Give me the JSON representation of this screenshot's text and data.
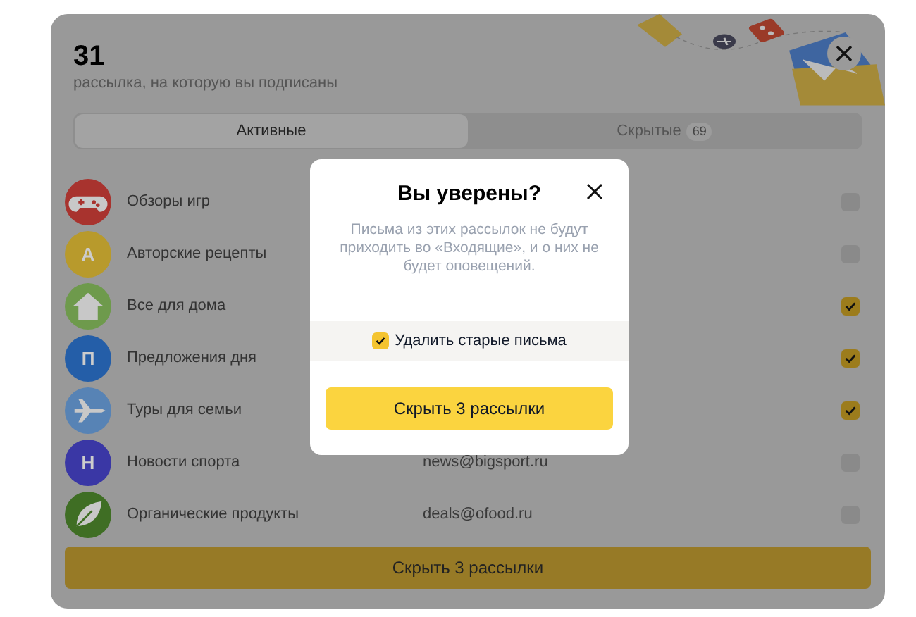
{
  "header": {
    "count": "31",
    "subtitle": "рассылка, на которую вы подписаны"
  },
  "tabs": [
    {
      "label": "Активные",
      "selected": true
    },
    {
      "label": "Скрытые",
      "badge": "69",
      "selected": false
    }
  ],
  "subscriptions": [
    {
      "name": "Обзоры игр",
      "checked": false,
      "color": "#a8332e",
      "avatar": {
        "kind": "gamepad"
      }
    },
    {
      "name": "Авторские рецепты",
      "checked": false,
      "color": "#b89a2c",
      "avatar": {
        "kind": "letter",
        "letter": "А"
      }
    },
    {
      "name": "Все для дома",
      "checked": true,
      "color": "#6e9a4c",
      "avatar": {
        "kind": "house"
      }
    },
    {
      "name": "Предложения дня",
      "checked": true,
      "color": "#245ea8",
      "avatar": {
        "kind": "letter",
        "letter": "П"
      }
    },
    {
      "name": "Туры для семьи",
      "checked": true,
      "color": "#5783b5",
      "avatar": {
        "kind": "plane"
      }
    },
    {
      "name": "Новости спорта",
      "email": "news@bigsport.ru",
      "checked": false,
      "color": "#3a37a5",
      "avatar": {
        "kind": "letter",
        "letter": "Н"
      }
    },
    {
      "name": "Органические продукты",
      "email": "deals@ofood.ru",
      "checked": false,
      "color": "#3f6e24",
      "avatar": {
        "kind": "leaf"
      }
    }
  ],
  "footer_button": "Скрыть 3 рассылки",
  "dialog": {
    "title": "Вы уверены?",
    "message": "Письма из этих рассылок не будут приходить во «Входящие», и о них не будет оповещений.",
    "option": {
      "label": "Удалить старые письма",
      "checked": true
    },
    "button": "Скрыть 3 рассылки"
  }
}
